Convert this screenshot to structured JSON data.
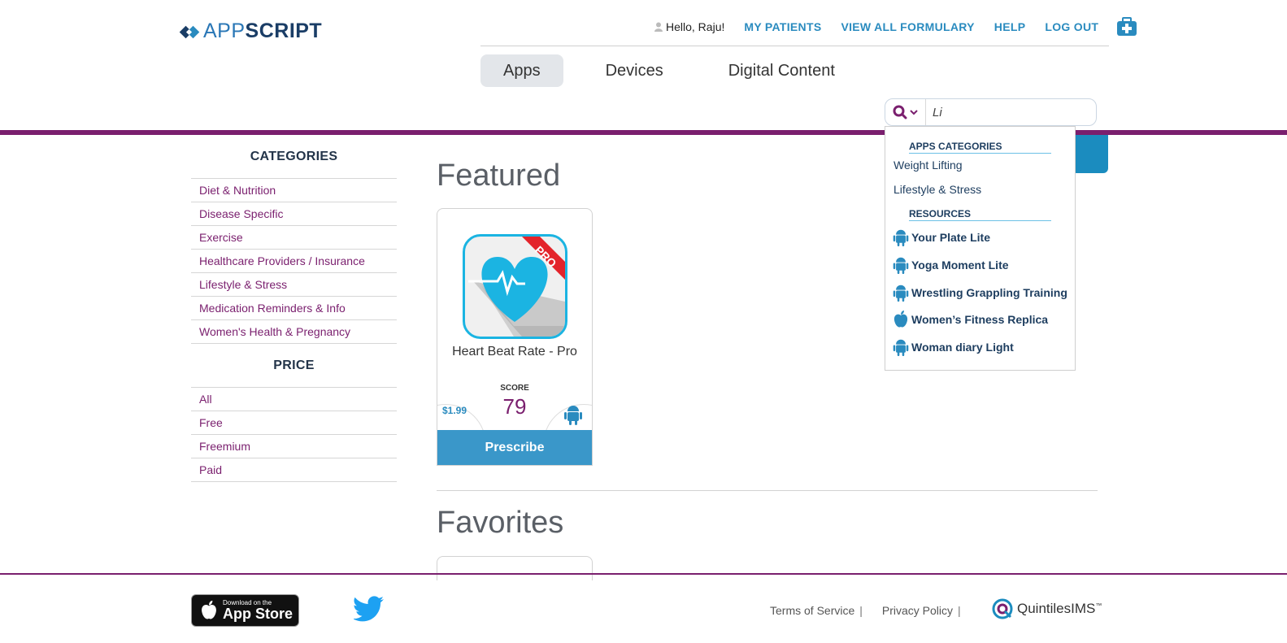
{
  "brand": {
    "logo_light": "APP",
    "logo_bold": "SCRIPT"
  },
  "topnav": {
    "greeting": "Hello, Raju!",
    "links": [
      "MY PATIENTS",
      "VIEW ALL FORMULARY",
      "HELP",
      "LOG OUT"
    ]
  },
  "tabs": [
    {
      "label": "Apps",
      "active": true
    },
    {
      "label": "Devices",
      "active": false
    },
    {
      "label": "Digital Content",
      "active": false
    }
  ],
  "search": {
    "value": "Li",
    "placeholder": ""
  },
  "sidebar": {
    "categories_heading": "CATEGORIES",
    "categories": [
      "Diet & Nutrition",
      "Disease Specific",
      "Exercise",
      "Healthcare Providers / Insurance",
      "Lifestyle & Stress",
      "Medication Reminders & Info",
      "Women's Health & Pregnancy"
    ],
    "price_heading": "PRICE",
    "prices": [
      "All",
      "Free",
      "Freemium",
      "Paid"
    ]
  },
  "main": {
    "featured_title": "Featured",
    "favorites_title": "Favorites",
    "featured_card": {
      "badge": "PRO",
      "name": "Heart Beat Rate - Pro",
      "score_label": "SCORE",
      "score": "79",
      "price": "$1.99",
      "platform": "android-icon",
      "button": "Prescribe"
    }
  },
  "dropdown": {
    "apps_categories_heading": "APPS CATEGORIES",
    "categories": [
      "Weight Lifting",
      "Lifestyle & Stress"
    ],
    "resources_heading": "RESOURCES",
    "resources": [
      {
        "label": "Your Plate Lite",
        "platform": "android-icon"
      },
      {
        "label": "Yoga Moment Lite",
        "platform": "android-icon"
      },
      {
        "label": "Wrestling Grappling Training",
        "platform": "android-icon"
      },
      {
        "label": "Women’s Fitness Replica",
        "platform": "apple-icon"
      },
      {
        "label": "Woman diary Light",
        "platform": "android-icon"
      }
    ]
  },
  "footer": {
    "appstore_small": "Download on the",
    "appstore_big": "App Store",
    "links": [
      "Terms of Service",
      "Privacy Policy"
    ],
    "separator": "|",
    "partner": "QuintilesIMS",
    "partner_tm": "™"
  },
  "colors": {
    "brand_purple": "#7a1f6e",
    "accent_blue": "#2a8bbf",
    "button_blue": "#3a97c9",
    "navy": "#1d3d5f"
  }
}
